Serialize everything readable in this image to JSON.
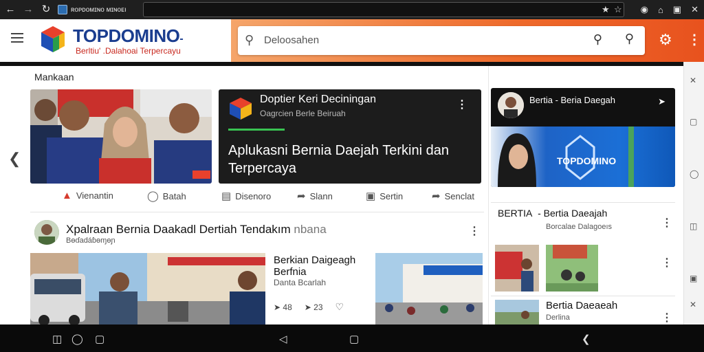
{
  "browser": {
    "tab_title": "ʀᴏᴘᴅᴏᴍɪɴᴏ ᴍɪɴᴏᴇı",
    "back_icon": "back-arrow-icon",
    "forward_icon": "forward-arrow-icon",
    "reload_icon": "reload-icon"
  },
  "header": {
    "brand": "TOPDOMINO",
    "brand_suffix": "-",
    "tagline": "Berltiu' .Dalahoai Terpercayu",
    "search_placeholder": "Deloosahen",
    "accent_color": "#e8521e"
  },
  "main": {
    "section_label": "Mankaan",
    "hero": {
      "title": "Doptier Keri Deciningan",
      "subtitle": "Oagrcien Berle Beiruah",
      "headline": "Aplukasni Bernia Daejah Terkini dan Terpercaya"
    },
    "actions": [
      {
        "label": "Vienantin",
        "icon": "thumb-up-icon"
      },
      {
        "label": "Batah",
        "icon": "comment-icon"
      },
      {
        "label": "Disenoro",
        "icon": "list-icon"
      },
      {
        "label": "Slann",
        "icon": "share-icon"
      },
      {
        "label": "Sertin",
        "icon": "bookmark-icon"
      },
      {
        "label": "Senclat",
        "icon": "forward-icon"
      }
    ],
    "post": {
      "title": "Xpalraan Bernia Daakadl Dertiah Tendakım",
      "title_tail": "nbana",
      "subtitle": "Bɵɗadáɓɵɱɵɲ",
      "article_title": "Berkian Daigeagh Berfnia",
      "article_sub": "Danta Bcarlah",
      "stat_likes": "48",
      "stat_comments": "23"
    }
  },
  "sidebar": {
    "card": {
      "title": "Bertia - Beria Daegah",
      "banner_brand": "TOPDOMINO"
    },
    "section": {
      "title": "BERTIA",
      "title_tail": "- Bertia Daeajah",
      "subtitle": "Borcalae Dalagoeıs"
    },
    "item3": {
      "title": "Bertia Daeaeah",
      "subtitle": "Derlina"
    }
  }
}
